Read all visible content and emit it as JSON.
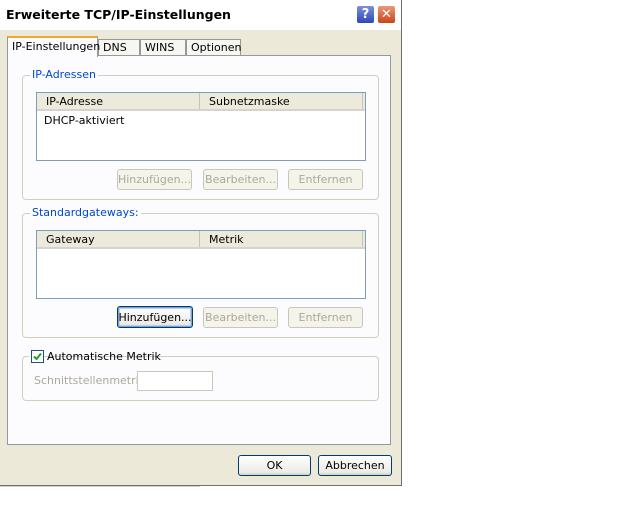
{
  "window": {
    "title": "Erweiterte TCP/IP-Einstellungen",
    "help_glyph": "?",
    "close_glyph": "✕"
  },
  "tabs": [
    {
      "label": "IP-Einstellungen",
      "active": true
    },
    {
      "label": "DNS",
      "active": false
    },
    {
      "label": "WINS",
      "active": false
    },
    {
      "label": "Optionen",
      "active": false
    }
  ],
  "ip_group": {
    "legend": "IP-Adressen",
    "columns": [
      "IP-Adresse",
      "Subnetzmaske"
    ],
    "rows": [
      [
        "DHCP-aktiviert",
        ""
      ]
    ],
    "buttons": {
      "add": "Hinzufügen...",
      "edit": "Bearbeiten...",
      "remove": "Entfernen"
    }
  },
  "gateway_group": {
    "legend": "Standardgateways:",
    "columns": [
      "Gateway",
      "Metrik"
    ],
    "rows": [],
    "buttons": {
      "add": "Hinzufügen...",
      "edit": "Bearbeiten...",
      "remove": "Entfernen"
    }
  },
  "metric_group": {
    "checkbox_label": "Automatische Metrik",
    "checked": true,
    "interface_metric_label": "Schnittstellenmetrik:",
    "interface_metric_value": ""
  },
  "footer": {
    "ok": "OK",
    "cancel": "Abbrechen"
  },
  "colors": {
    "accent_tab": "#f1a731",
    "legend_text": "#0046d5",
    "close_button": "#c9441a",
    "help_button": "#2e47b8"
  }
}
